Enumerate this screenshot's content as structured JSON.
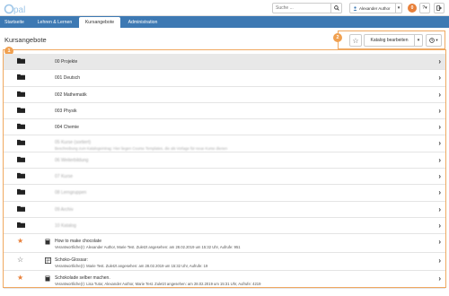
{
  "colors": {
    "navbar": "#3d79b3",
    "accent": "#f0a050",
    "star": "#e8803a",
    "folder": "#222222"
  },
  "topbar": {
    "search_placeholder": "Suche ...",
    "user_name": "Alexander Author",
    "notification_count": "0"
  },
  "nav": {
    "tabs": [
      {
        "label": "Startseite"
      },
      {
        "label": "Lehren & Lernen"
      },
      {
        "label": "Kursangebote",
        "active": true
      },
      {
        "label": "Administration"
      }
    ]
  },
  "header": {
    "title": "Kursangebote",
    "katalog_label": "Katalog bearbeiten",
    "badge_list": "1",
    "badge_toolbar": "2"
  },
  "rows": [
    {
      "type": "folder",
      "title": "00 Projekte"
    },
    {
      "type": "folder",
      "title": "001 Deutsch"
    },
    {
      "type": "folder",
      "title": "002 Mathematik"
    },
    {
      "type": "folder",
      "title": "003 Physik"
    },
    {
      "type": "folder",
      "title": "004 Chemie"
    },
    {
      "type": "folder",
      "title": "05 Kurse (sortiert)",
      "meta": "Beschreibung zum Katalogeintrag: Hier liegen Course Templates, die als Vorlage für neue Kurse dienen",
      "blurred": true
    },
    {
      "type": "folder",
      "title": "06 Weiterbildung",
      "blurred": true
    },
    {
      "type": "folder",
      "title": "07 Kurse",
      "blurred": true
    },
    {
      "type": "folder",
      "title": "08 Lerngruppen",
      "blurred": true
    },
    {
      "type": "folder",
      "title": "09 Archiv",
      "blurred": true
    },
    {
      "type": "folder",
      "title": "10 Katalog",
      "blurred": true
    },
    {
      "type": "course",
      "starred": true,
      "title": "How to make chocolate",
      "meta": "Verantwortliche(r): Alexander Author, Marie Test. Zuletzt angesehen: am 28.02.2019 um 15:32 Uhr, Aufrufe: 951"
    },
    {
      "type": "glossary",
      "starred": false,
      "title": "Schoko-Glossar:",
      "meta": "Verantwortliche(r): Marie Test. Zuletzt angesehen: am 28.02.2019 um 15:32 Uhr, Aufrufe: 19"
    },
    {
      "type": "course",
      "starred": true,
      "title": "Schokolade selber machen.",
      "meta": "Verantwortliche(r): Lisa Tutor, Alexander Author, Marie Test. Zuletzt angesehen: am 28.02.2019 um 15:31 Uhr, Aufrufe: 4219"
    }
  ]
}
